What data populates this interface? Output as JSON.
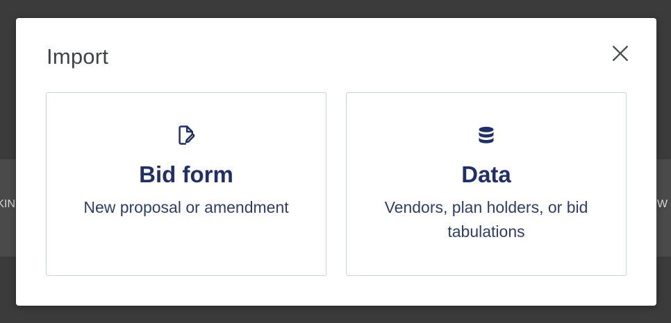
{
  "background": {
    "left_fragment": "KIN",
    "right_fragment": "W"
  },
  "modal": {
    "title": "Import",
    "close_icon": "close-icon"
  },
  "cards": [
    {
      "icon": "document-edit-icon",
      "title": "Bid form",
      "description": "New proposal or amendment"
    },
    {
      "icon": "database-icon",
      "title": "Data",
      "description": "Vendors, plan holders, or bid tabulations"
    }
  ],
  "colors": {
    "overlay": "#3b3b3b",
    "modal_bg": "#ffffff",
    "title_text": "#3f4347",
    "card_title": "#1f2f6b",
    "card_desc": "#2d3d6e",
    "card_border": "#cdd1d8"
  }
}
